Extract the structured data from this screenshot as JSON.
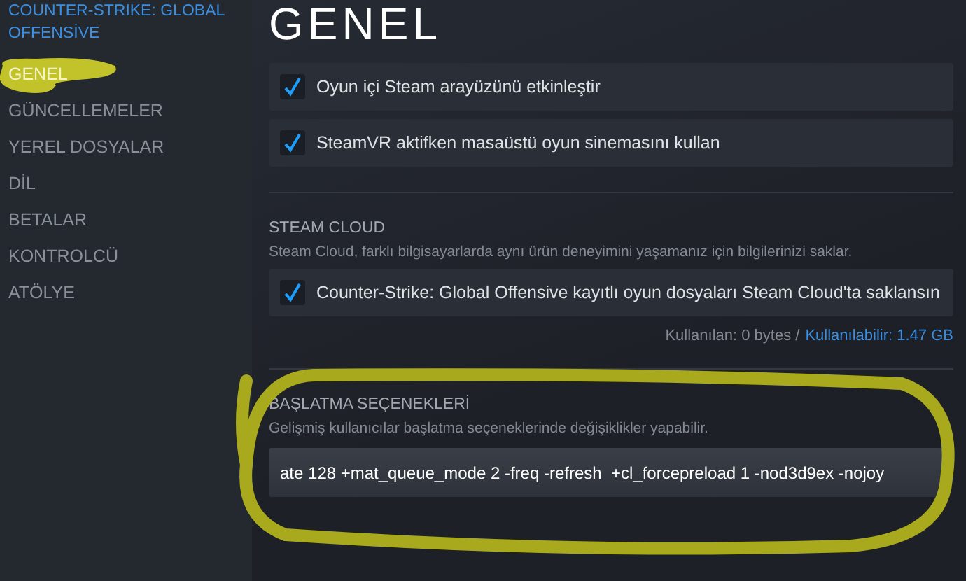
{
  "sidebar": {
    "app_title": "COUNTER-STRIKE: GLOBAL OFFENSİVE",
    "items": [
      {
        "label": "GENEL",
        "selected": true
      },
      {
        "label": "GÜNCELLEMELER",
        "selected": false
      },
      {
        "label": "YEREL DOSYALAR",
        "selected": false
      },
      {
        "label": "DİL",
        "selected": false
      },
      {
        "label": "BETALAR",
        "selected": false
      },
      {
        "label": "KONTROLCÜ",
        "selected": false
      },
      {
        "label": "ATÖLYE",
        "selected": false
      }
    ]
  },
  "page_title": "GENEL",
  "general_options": [
    {
      "label": "Oyun içi Steam arayüzünü etkinleştir",
      "checked": true
    },
    {
      "label": "SteamVR aktifken masaüstü oyun sinemasını kullan",
      "checked": true
    }
  ],
  "steam_cloud": {
    "heading": "STEAM CLOUD",
    "description": "Steam Cloud, farklı bilgisayarlarda aynı ürün deneyimini yaşamanız için bilgilerinizi saklar.",
    "option": {
      "label": "Counter-Strike: Global Offensive kayıtlı oyun dosyaları Steam Cloud'ta saklansın",
      "checked": true
    },
    "used": "Kullanılan: 0 bytes /",
    "available": "Kullanılabilir: 1.47 GB"
  },
  "launch_options": {
    "heading": "BAŞLATMA SEÇENEKLERİ",
    "description": "Gelişmiş kullanıcılar başlatma seçeneklerinde değişiklikler yapabilir.",
    "value": "ate 128 +mat_queue_mode 2 -freq -refresh  +cl_forcepreload 1 -nod3d9ex -nojoy"
  }
}
